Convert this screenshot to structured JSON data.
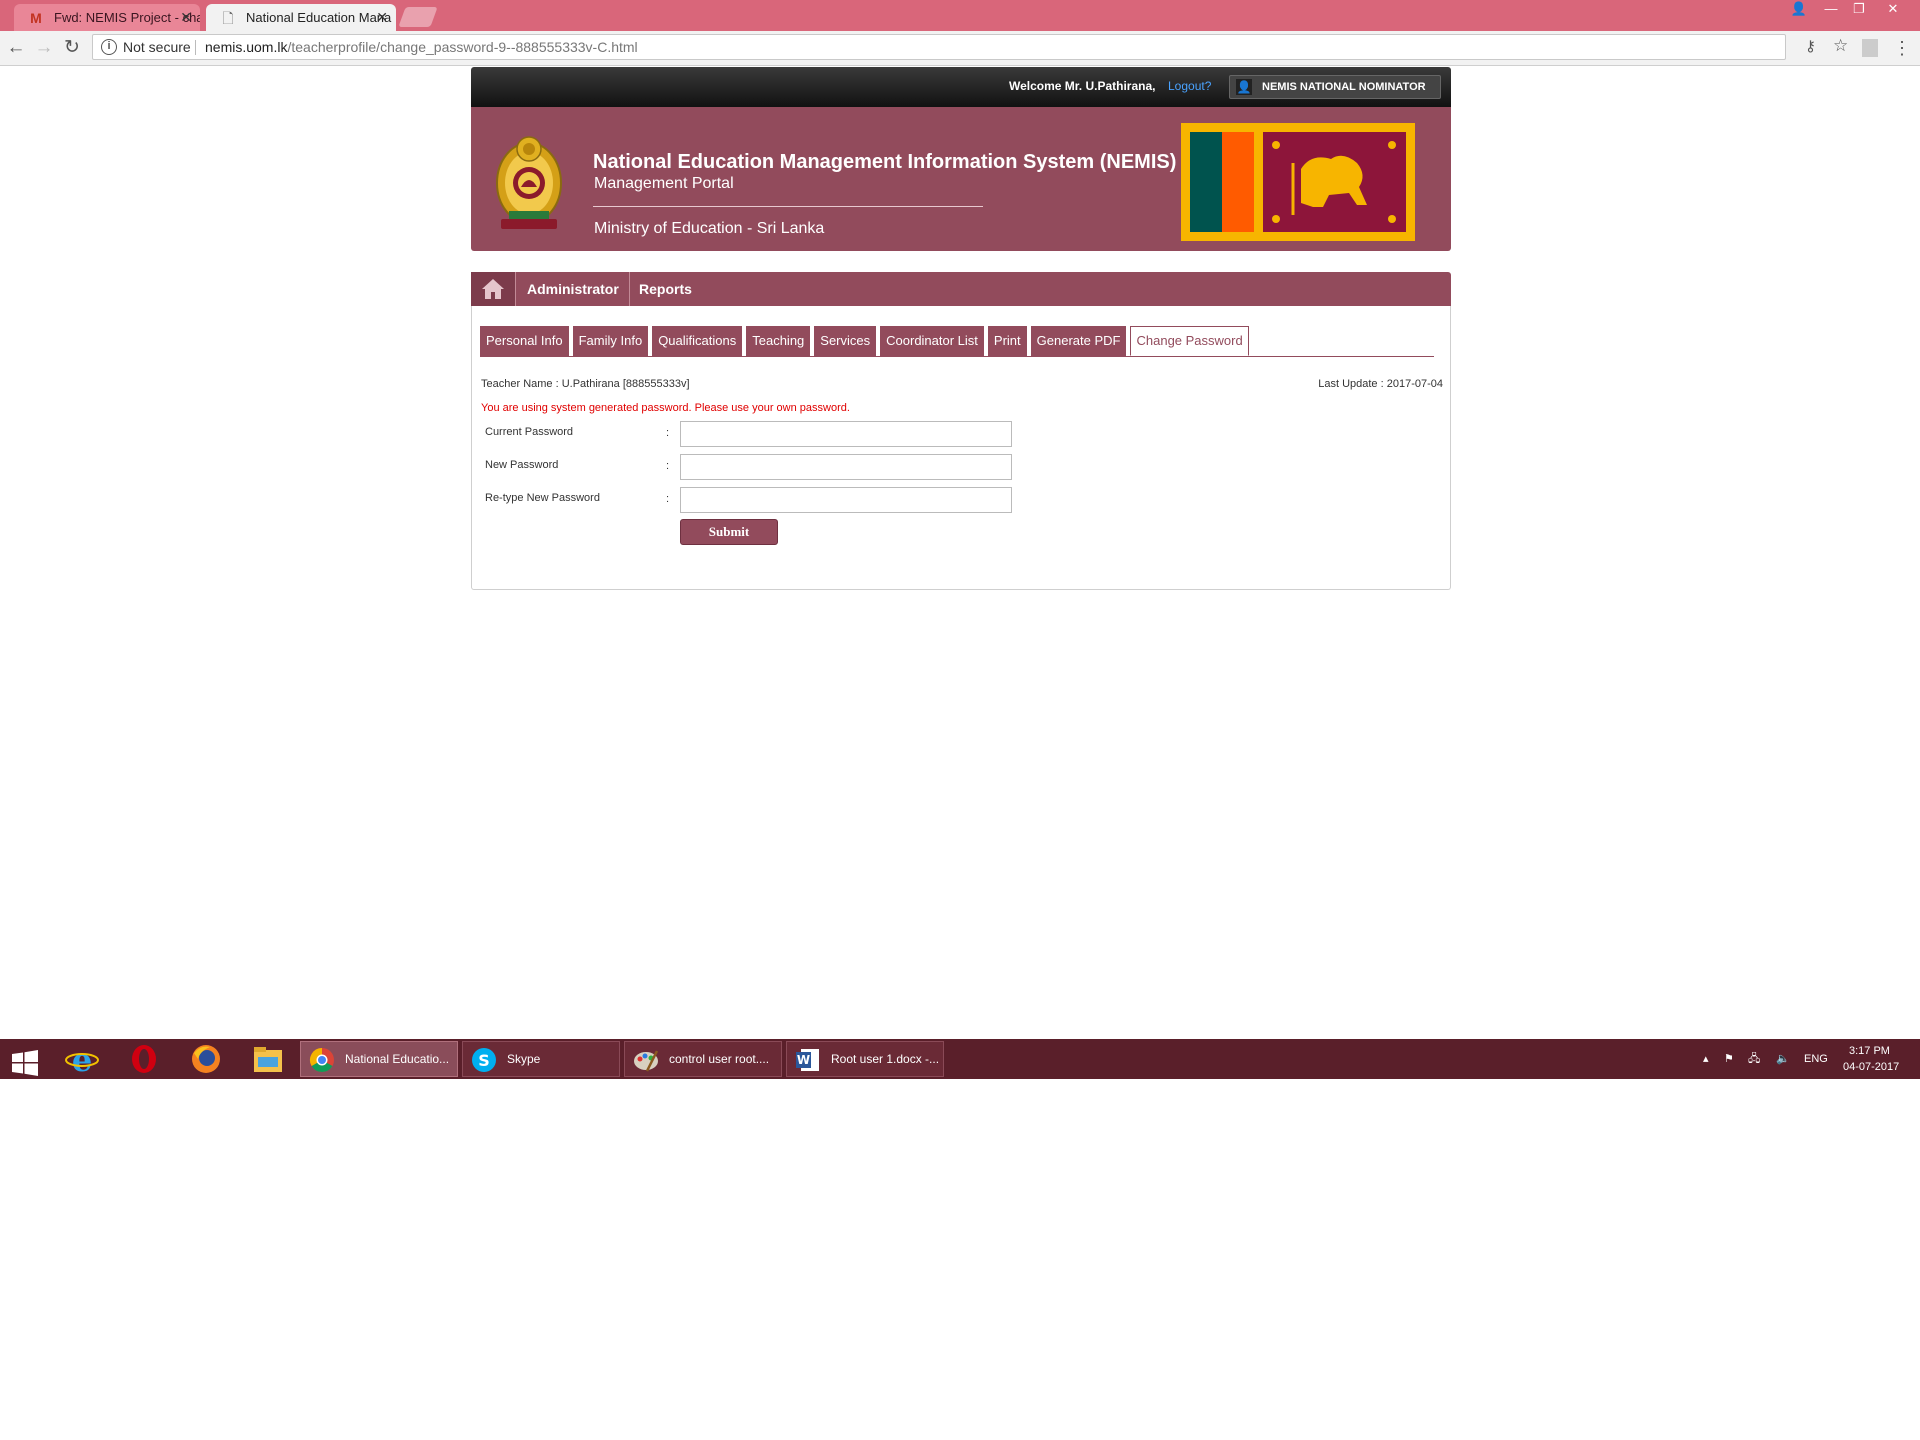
{
  "browser": {
    "tabs": [
      {
        "title": "Fwd: NEMIS Project - cha",
        "icon": "gmail-icon",
        "active": false
      },
      {
        "title": "National Education Mana",
        "icon": "page-icon",
        "active": true
      }
    ],
    "security_label": "Not secure",
    "url_host": "nemis.uom.lk",
    "url_path": "/teacherprofile/change_password-9--888555333v-C.html"
  },
  "header": {
    "welcome": "Welcome Mr. U.Pathirana,",
    "logout": "Logout?",
    "role": "NEMIS NATIONAL NOMINATOR",
    "title": "National Education Management Information System (NEMIS)",
    "subtitle": "Management Portal",
    "ministry": "Ministry of Education - Sri Lanka"
  },
  "menu": {
    "items": [
      "Administrator",
      "Reports"
    ]
  },
  "subtabs": [
    {
      "label": "Personal Info",
      "active": false
    },
    {
      "label": "Family Info",
      "active": false
    },
    {
      "label": "Qualifications",
      "active": false
    },
    {
      "label": "Teaching",
      "active": false
    },
    {
      "label": "Services",
      "active": false
    },
    {
      "label": "Coordinator List",
      "active": false
    },
    {
      "label": "Print",
      "active": false
    },
    {
      "label": "Generate PDF",
      "active": false
    },
    {
      "label": "Change Password",
      "active": true
    }
  ],
  "form": {
    "teacher_name": "Teacher Name : U.Pathirana [888555333v]",
    "last_update": "Last Update : 2017-07-04",
    "warning": "You are using system generated password. Please use your own password.",
    "fields": [
      {
        "label": "Current Password",
        "colon": ":",
        "value": ""
      },
      {
        "label": "New Password",
        "colon": ":",
        "value": ""
      },
      {
        "label": "Re-type New Password",
        "colon": ":",
        "value": ""
      }
    ],
    "submit": "Submit"
  },
  "taskbar": {
    "apps": [
      {
        "label": "National Educatio...",
        "icon": "chrome-icon",
        "active": true
      },
      {
        "label": "Skype",
        "icon": "skype-icon",
        "active": false
      },
      {
        "label": "control user root....",
        "icon": "paint-icon",
        "active": false
      },
      {
        "label": "Root user 1.docx -...",
        "icon": "word-icon",
        "active": false
      }
    ],
    "language": "ENG",
    "time": "3:17 PM",
    "date": "04-07-2017"
  },
  "colors": {
    "brand": "#924b5c",
    "tabstrip": "#d9667a",
    "taskbar": "#5a1f2a",
    "warning": "#e00000",
    "logout_link": "#4aa3ff"
  }
}
